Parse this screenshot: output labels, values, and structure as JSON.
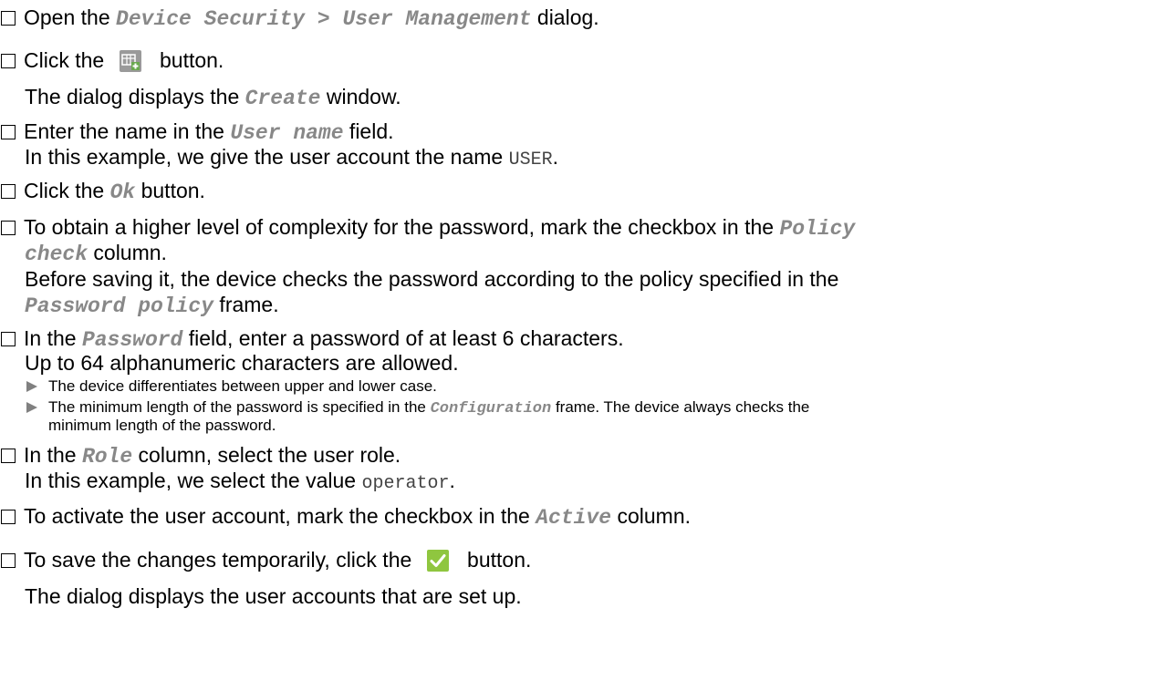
{
  "steps": [
    {
      "a": "Open the ",
      "b": "Device Security > User Management",
      "c": " dialog."
    },
    {
      "a": "Click the ",
      "icon": "create-table-icon",
      "c": " button."
    },
    {
      "a": "The dialog displays the ",
      "b": "Create",
      "c": " window."
    },
    {
      "a": "Enter the name in the ",
      "b": "User name",
      "c": " field."
    },
    {
      "a": "In this example, we give the user account the name ",
      "code": "USER",
      "c": "."
    },
    {
      "a": "Click the ",
      "b": "Ok",
      "c": " button."
    },
    {
      "a": "To obtain a higher level of complexity for the password, mark the checkbox in the ",
      "b": "Policy"
    },
    {
      "b": "check",
      "c": " column."
    },
    {
      "a": "Before saving it, the device checks the password according to the policy specified in the"
    },
    {
      "b": "Password policy",
      "c": " frame."
    },
    {
      "a": "In the ",
      "b": "Password",
      "c": " field, enter a password of at least 6 characters."
    },
    {
      "a": "Up to 64 alphanumeric characters are allowed."
    },
    {
      "a": "The device differentiates between upper and lower case."
    },
    {
      "a": "The minimum length of the password is specified in the ",
      "b": "Configuration",
      "c": " frame. The device always checks the"
    },
    {
      "a": "minimum length of the password."
    },
    {
      "a": "In the ",
      "b": "Role",
      "c": " column, select the user role."
    },
    {
      "a": "In this example, we select the value ",
      "code": "operator",
      "c": "."
    },
    {
      "a": "To activate the user account, mark the checkbox in the ",
      "b": "Active",
      "c": " column."
    },
    {
      "a": "To save the changes temporarily, click the ",
      "icon": "checkmark-icon",
      "c": " button."
    },
    {
      "a": "The dialog displays the user accounts that are set up."
    }
  ],
  "colors": {
    "ui_term": "#888888",
    "bullet": "#808080",
    "save_button": "#8fc63f",
    "create_button": "#9a9a9a"
  }
}
